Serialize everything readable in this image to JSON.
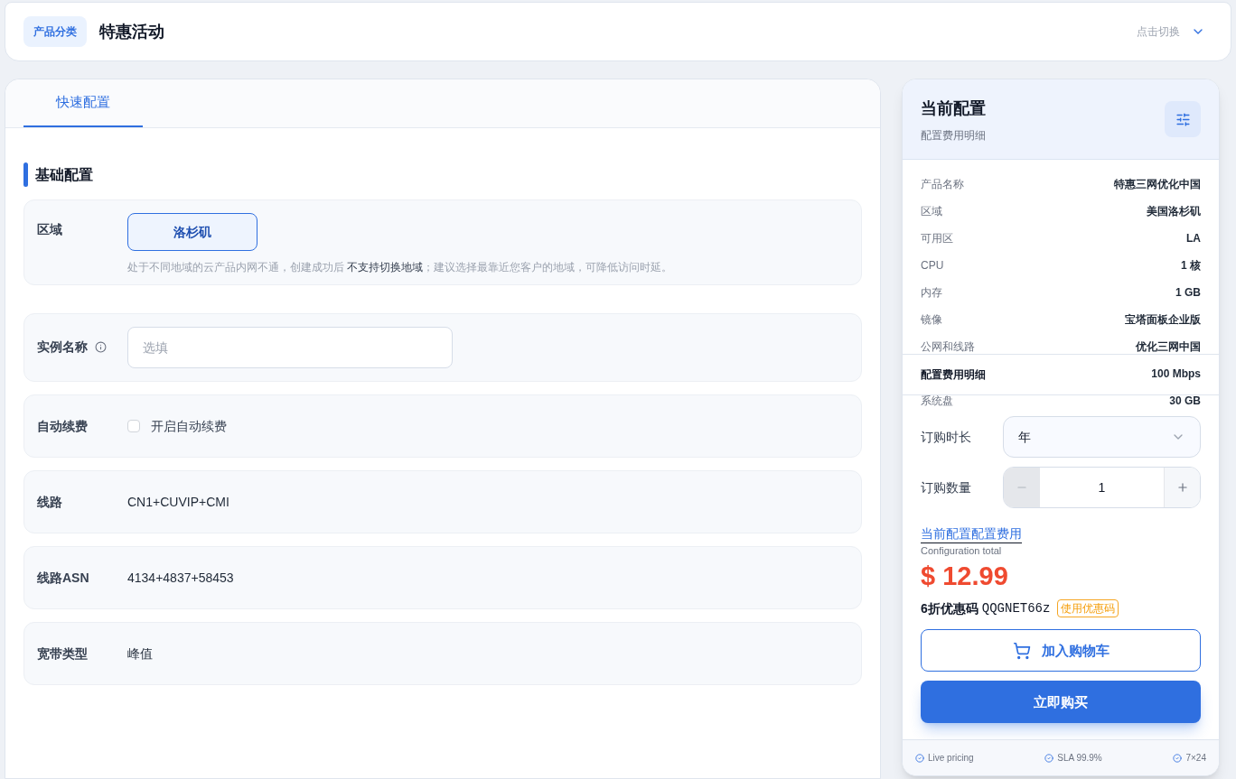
{
  "header": {
    "badge": "产品分类",
    "title": "特惠活动",
    "switch_label": "点击切换"
  },
  "tabs": [
    {
      "label": "快速配置",
      "selected": true
    }
  ],
  "sections": [
    {
      "title": "基础配置",
      "fields": [
        {
          "label": "区域",
          "options": [
            {
              "label": "洛杉矶",
              "selected": true
            }
          ],
          "hint": "处于不同地域的云产品内网不通，创建成功后 **不支持切换地域**；建议选择最靠近您客户的地域，可降低访问时延。"
        }
      ]
    }
  ],
  "fields": [
    {
      "kind": "input",
      "label": "实例名称",
      "info": true,
      "placeholder": "选填"
    },
    {
      "kind": "checkbox",
      "label": "自动续费",
      "option": "开启自动续费",
      "checked": false
    },
    {
      "kind": "text",
      "label": "线路",
      "value": "CN1+CUVIP+CMI"
    },
    {
      "kind": "text",
      "label": "线路ASN",
      "value": "4134+4837+58453"
    },
    {
      "kind": "text",
      "label": "宽带类型",
      "value": "峰值"
    }
  ],
  "summary": {
    "title": "当前配置",
    "subtitle": "配置费用明细",
    "rows": [
      {
        "label": "产品名称",
        "value": "特惠三网优化中国"
      },
      {
        "label": "区域",
        "value": "美国洛杉矶"
      },
      {
        "label": "可用区",
        "value": "LA"
      },
      {
        "label": "CPU",
        "value": "1 核"
      },
      {
        "label": "内存",
        "value": "1 GB"
      },
      {
        "label": "镜像",
        "value": "宝塔面板企业版"
      },
      {
        "label": "公网和线路",
        "value": "优化三网中国"
      },
      {
        "value": "100 Mbps"
      },
      {
        "label": "系统盘",
        "value": "30 GB"
      }
    ],
    "overlay_title": "配置费用明细",
    "duration": {
      "label": "订购时长",
      "value": "年"
    },
    "quantity": {
      "label": "订购数量",
      "value": "1",
      "minus_disabled": true
    },
    "total_link": "当前配置配置费用",
    "total_caption": "Configuration total",
    "price": "$ 12.99",
    "coupon": {
      "label": "6折优惠码",
      "code": "QQGNET66z",
      "action": "使用优惠码"
    },
    "buttons": [
      {
        "kind": "outline",
        "label": "加入购物车"
      },
      {
        "kind": "primary",
        "label": "立即购买"
      }
    ],
    "footer": [
      "Live pricing",
      "SLA 99.9%",
      "7×24"
    ]
  }
}
